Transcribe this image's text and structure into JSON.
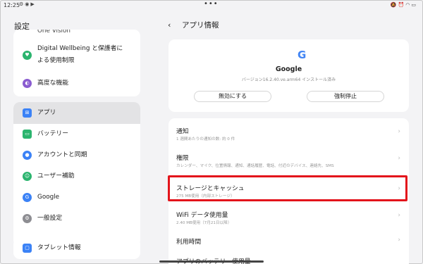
{
  "status_bar": {
    "time": "12:25",
    "left_icons": [
      "gear-icon",
      "location-icon",
      "youtube-icon"
    ],
    "right_icons": [
      "silent-icon",
      "alarm-icon",
      "wifi-icon",
      "battery-icon"
    ]
  },
  "left": {
    "title": "設定",
    "partial_item": "One Vision",
    "items": [
      {
        "label": "Digital Wellbeing と保護者に",
        "label2": "よる使用制限",
        "icon": "wellbeing-icon",
        "color": "#2bb46e"
      },
      {
        "label": "高度な機能",
        "icon": "advanced-features-icon",
        "color": "#8a5cd0"
      },
      {
        "label": "アプリ",
        "icon": "apps-icon",
        "color": "#3b82f6",
        "selected": true
      },
      {
        "label": "バッテリー",
        "icon": "battery-icon",
        "color": "#2bb46e"
      },
      {
        "label": "アカウントと同期",
        "icon": "account-icon",
        "color": "#3b82f6"
      },
      {
        "label": "ユーザー補助",
        "icon": "accessibility-icon",
        "color": "#2bb46e"
      },
      {
        "label": "Google",
        "icon": "google-icon",
        "color": "#3b82f6"
      },
      {
        "label": "一般設定",
        "icon": "general-settings-icon",
        "color": "#8d8d92"
      },
      {
        "label": "タブレット情報",
        "icon": "tablet-info-icon",
        "color": "#3b82f6"
      }
    ]
  },
  "right": {
    "title": "アプリ情報",
    "app": {
      "name": "Google",
      "version": "バージョン16.2.40.ve.arm64 インストール済み",
      "disable_label": "無効にする",
      "force_stop_label": "強制停止"
    },
    "rows": [
      {
        "title": "通知",
        "subtitle": "1 週間あたりの通知の数: 約 0 件"
      },
      {
        "title": "権限",
        "subtitle": "カレンダー、マイク、位置情報、通知、通話履歴、電話、付近のデバイス、連絡先、SMS"
      },
      {
        "title": "ストレージとキャッシュ",
        "subtitle": "275 MB使用（内部ストレージ）"
      },
      {
        "title": "WiFi データ使用量",
        "subtitle": "2.40 MB使用（7月21日以降）"
      },
      {
        "title": "利用時間",
        "subtitle": ""
      },
      {
        "title": "アプリのバッテリー使用量",
        "subtitle": ""
      }
    ]
  },
  "colors": {
    "highlight": "#e3141b",
    "background": "#f3f3f5",
    "selected_bg": "#e3e3e5"
  }
}
